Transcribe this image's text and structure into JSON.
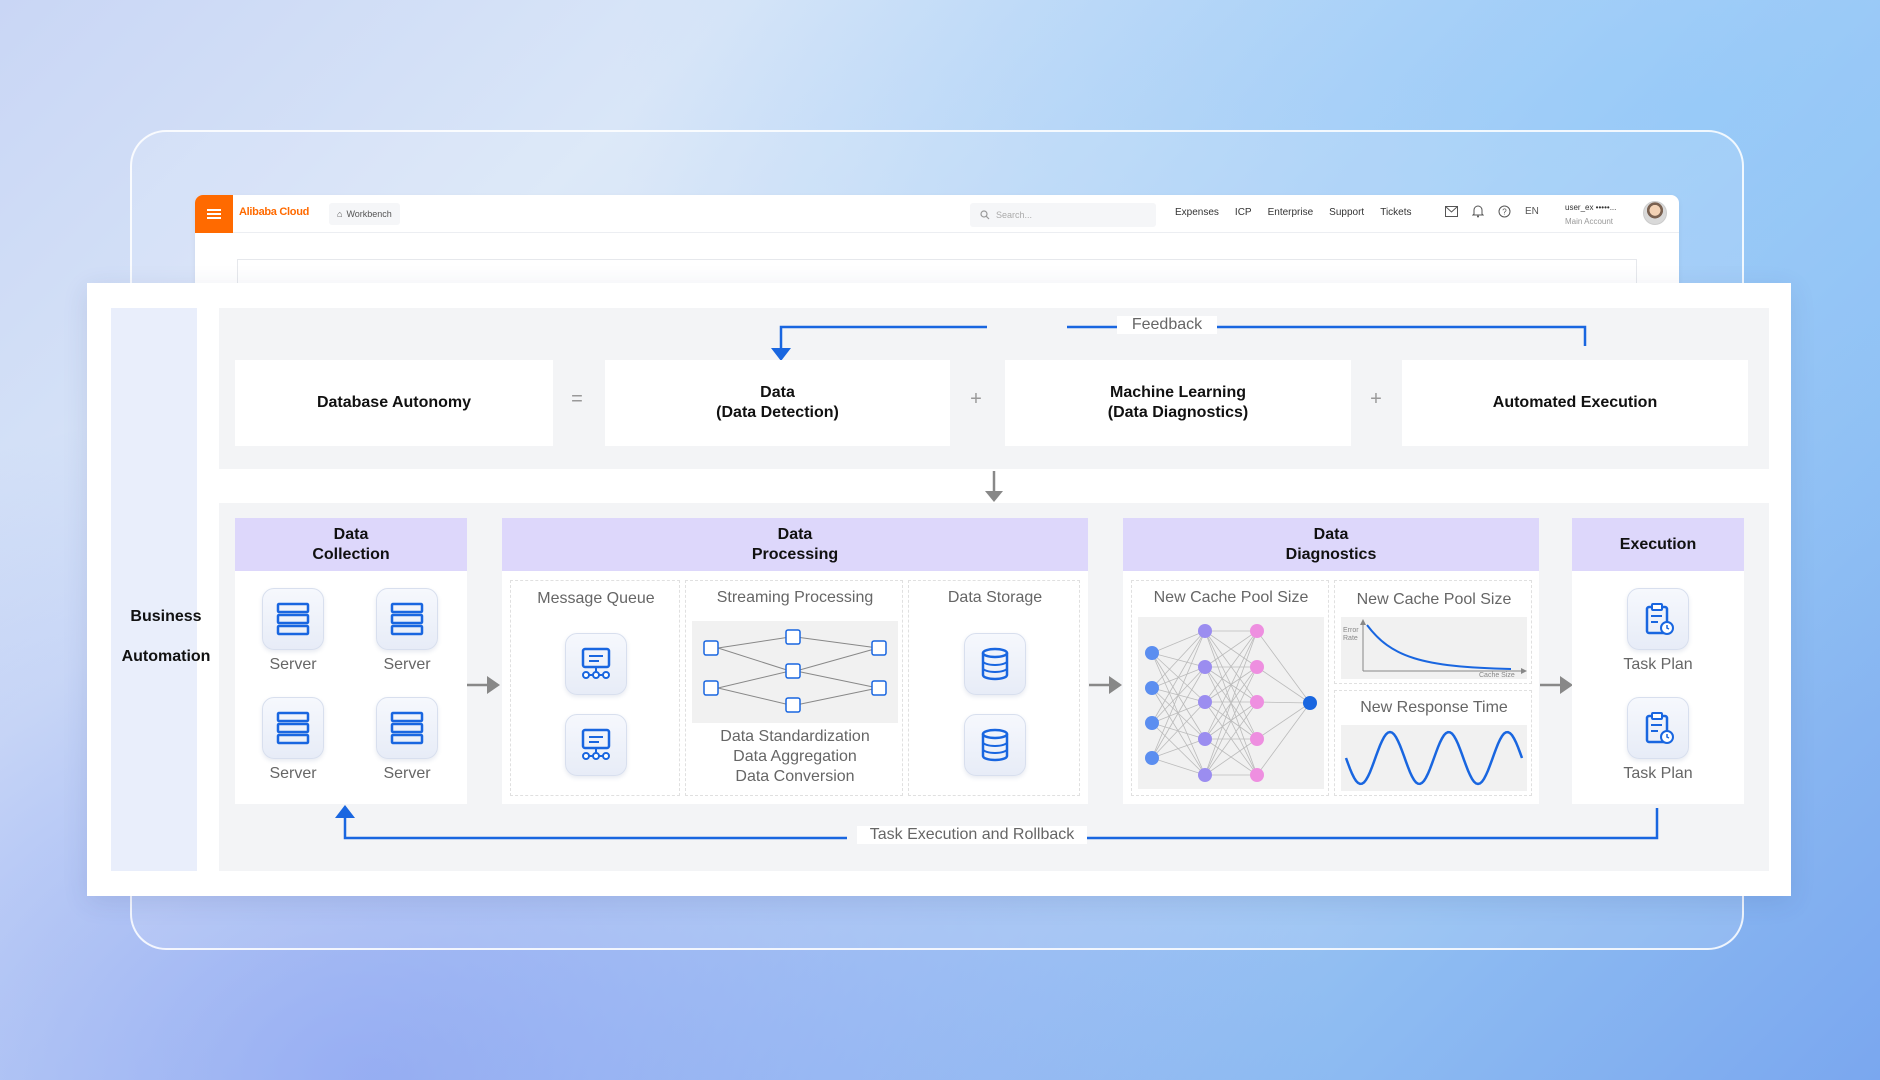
{
  "console": {
    "logo": "Alibaba Cloud",
    "workbench": "Workbench",
    "search_placeholder": "Search...",
    "nav": [
      "Expenses",
      "ICP",
      "Enterprise",
      "Support",
      "Tickets"
    ],
    "lang": "EN",
    "user_name": "user_ex •••••...",
    "user_role": "Main Account",
    "icons": [
      "mail-icon",
      "bell-icon",
      "help-icon"
    ]
  },
  "diagram": {
    "side_labels": [
      "Business",
      "Automation"
    ],
    "feedback_label": "Feedback",
    "equation": {
      "lhs": "Database Autonomy",
      "eq": "=",
      "terms": [
        {
          "line1": "Data",
          "line2": "(Data Detection)"
        },
        {
          "line1": "Machine Learning",
          "line2": "(Data Diagnostics)"
        },
        {
          "line1": "Automated Execution",
          "line2": ""
        }
      ],
      "plus": "+"
    },
    "stages": {
      "collection": {
        "title1": "Data",
        "title2": "Collection",
        "servers": [
          "Server",
          "Server",
          "Server",
          "Server"
        ]
      },
      "processing": {
        "title1": "Data",
        "title2": "Processing",
        "message_queue": "Message Queue",
        "streaming": "Streaming Processing",
        "storage": "Data Storage",
        "steps": [
          "Data Standardization",
          "Data Aggregation",
          "Data Conversion"
        ]
      },
      "diagnostics": {
        "title1": "Data",
        "title2": "Diagnostics",
        "nn_title": "New Cache Pool Size",
        "chart1_title": "New Cache Pool Size",
        "chart1_ylabel": "Error Rate",
        "chart1_xlabel": "Cache Size",
        "chart2_title": "New Response Time"
      },
      "execution": {
        "title": "Execution",
        "items": [
          "Task Plan",
          "Task Plan"
        ]
      }
    },
    "rollback_label": "Task Execution and Rollback",
    "colors": {
      "accent_blue": "#1966e0",
      "stage_header": "#ddd7fb",
      "nn_blue": "#5b8ef0",
      "nn_purple": "#9b8df0",
      "nn_pink": "#ee8fe0"
    }
  }
}
